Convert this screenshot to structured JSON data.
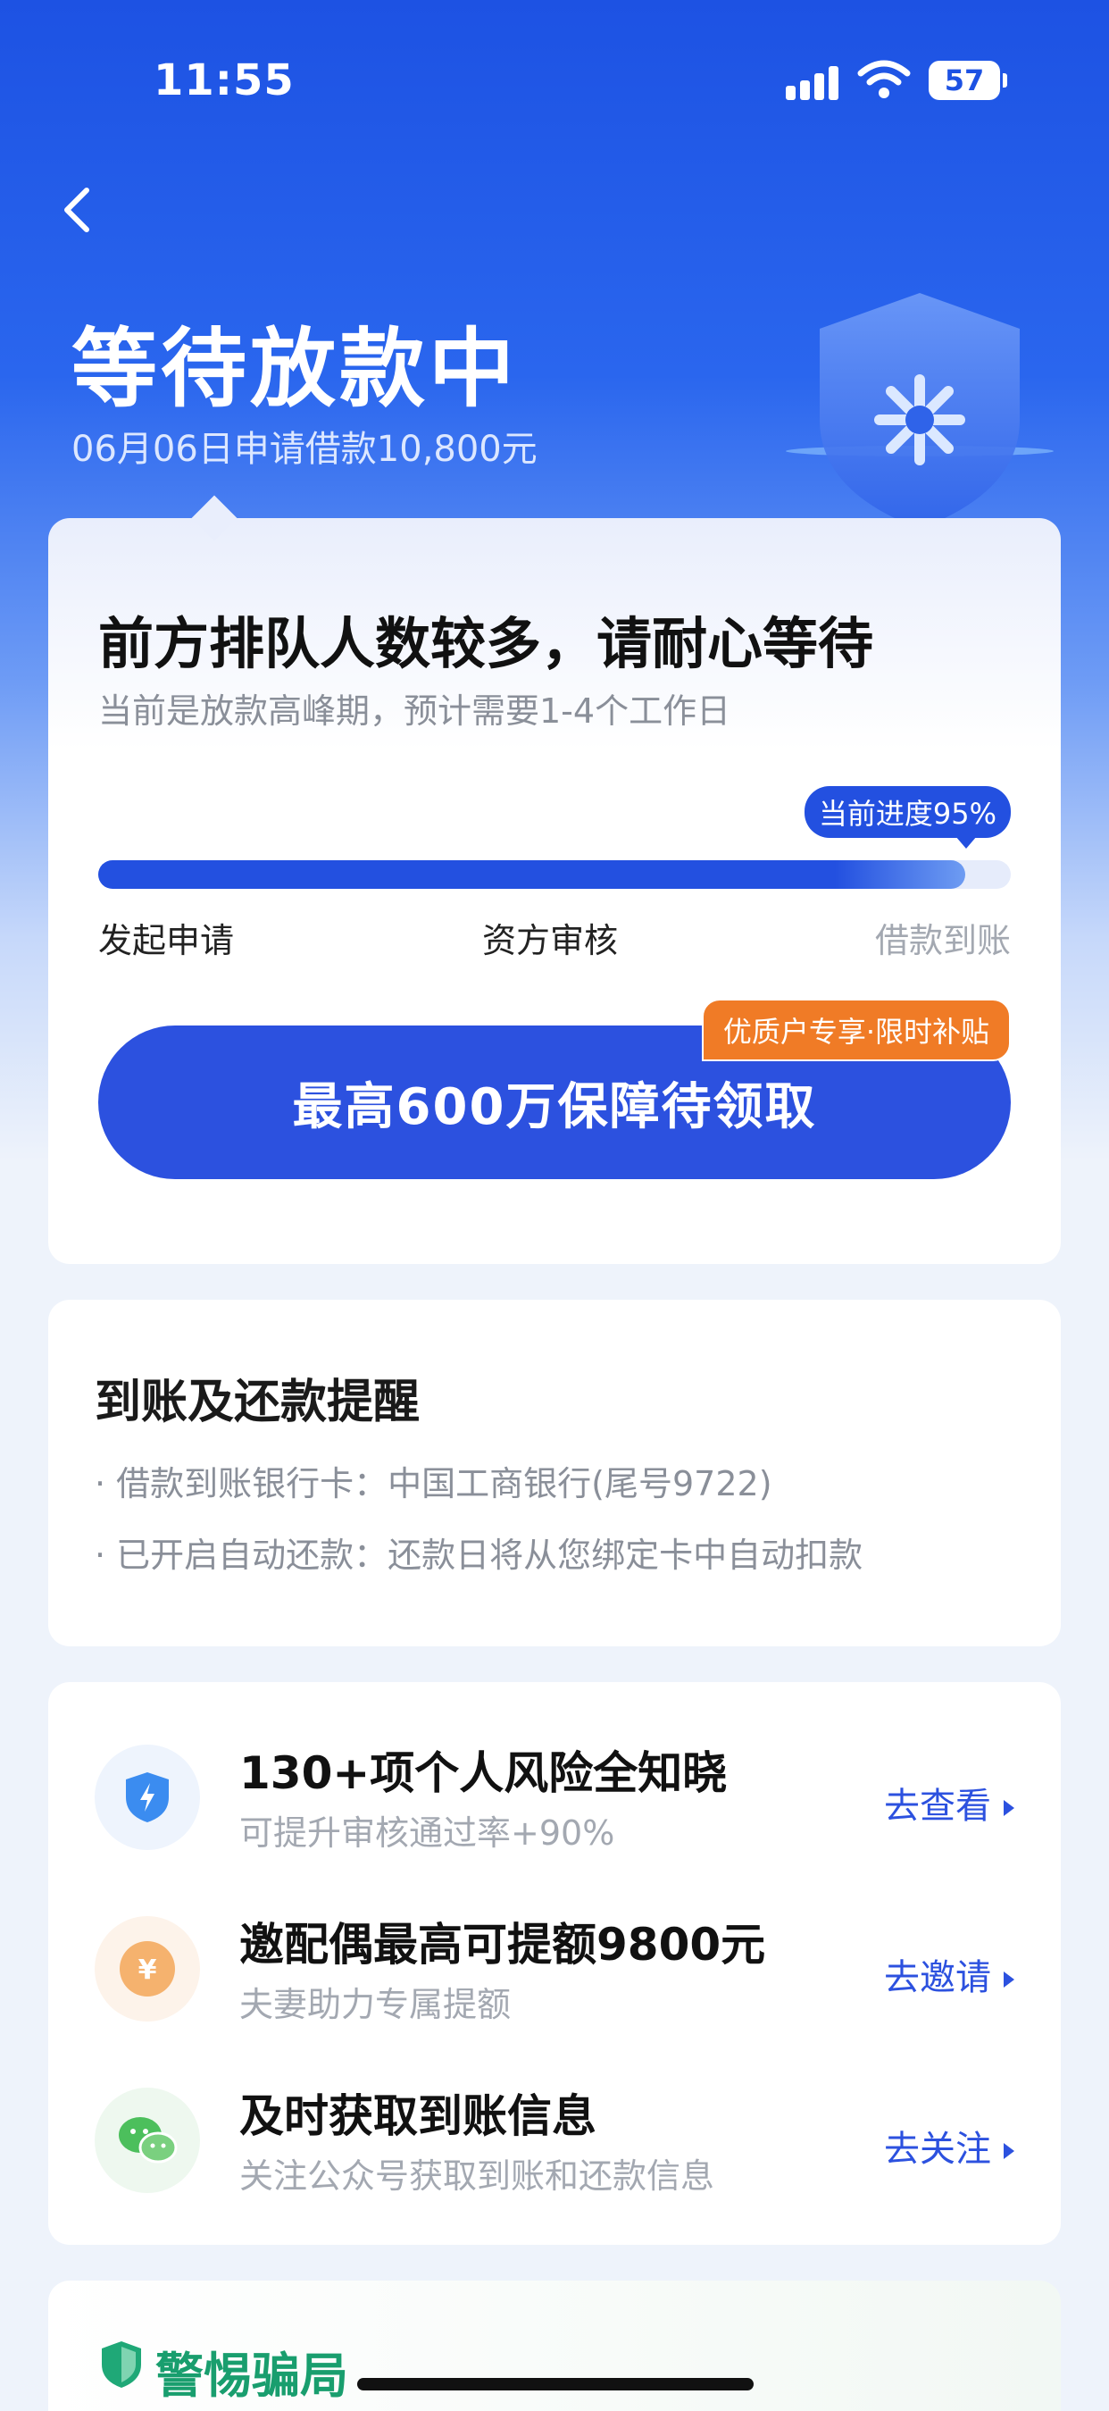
{
  "status_bar": {
    "time": "11:55",
    "battery": "57"
  },
  "header": {
    "title": "等待放款中",
    "subtitle": "06月06日申请借款10,800元"
  },
  "progress_card": {
    "heading": "前方排队人数较多，请耐心等待",
    "subheading": "当前是放款高峰期，预计需要1-4个工作日",
    "progress_label": "当前进度95%",
    "progress_value": 0.95,
    "steps": [
      "发起申请",
      "资方审核",
      "借款到账"
    ],
    "cta_label": "最高600万保障待领取",
    "promo_tag": "优质户专享·限时补贴"
  },
  "reminder_card": {
    "title": "到账及还款提醒",
    "items": [
      "· 借款到账银行卡：中国工商银行(尾号9722)",
      "· 已开启自动还款：还款日将从您绑定卡中自动扣款"
    ]
  },
  "feature_list": {
    "rows": [
      {
        "title": "130+项个人风险全知晓",
        "subtitle": "可提升审核通过率+90%",
        "link": "去查看",
        "icon": "shield-bolt-icon"
      },
      {
        "title": "邀配偶最高可提额9800元",
        "subtitle": "夫妻助力专属提额",
        "link": "去邀请",
        "icon": "yen-coin-icon"
      },
      {
        "title": "及时获取到账信息",
        "subtitle": "关注公众号获取到账和还款信息",
        "link": "去关注",
        "icon": "wechat-icon"
      }
    ]
  },
  "fraud_warning": {
    "title": "警惕骗局"
  },
  "colors": {
    "primary": "#2c51df",
    "promo": "#f07b26",
    "warning_green": "#199e6e",
    "hero_top": "#1d52e3"
  }
}
